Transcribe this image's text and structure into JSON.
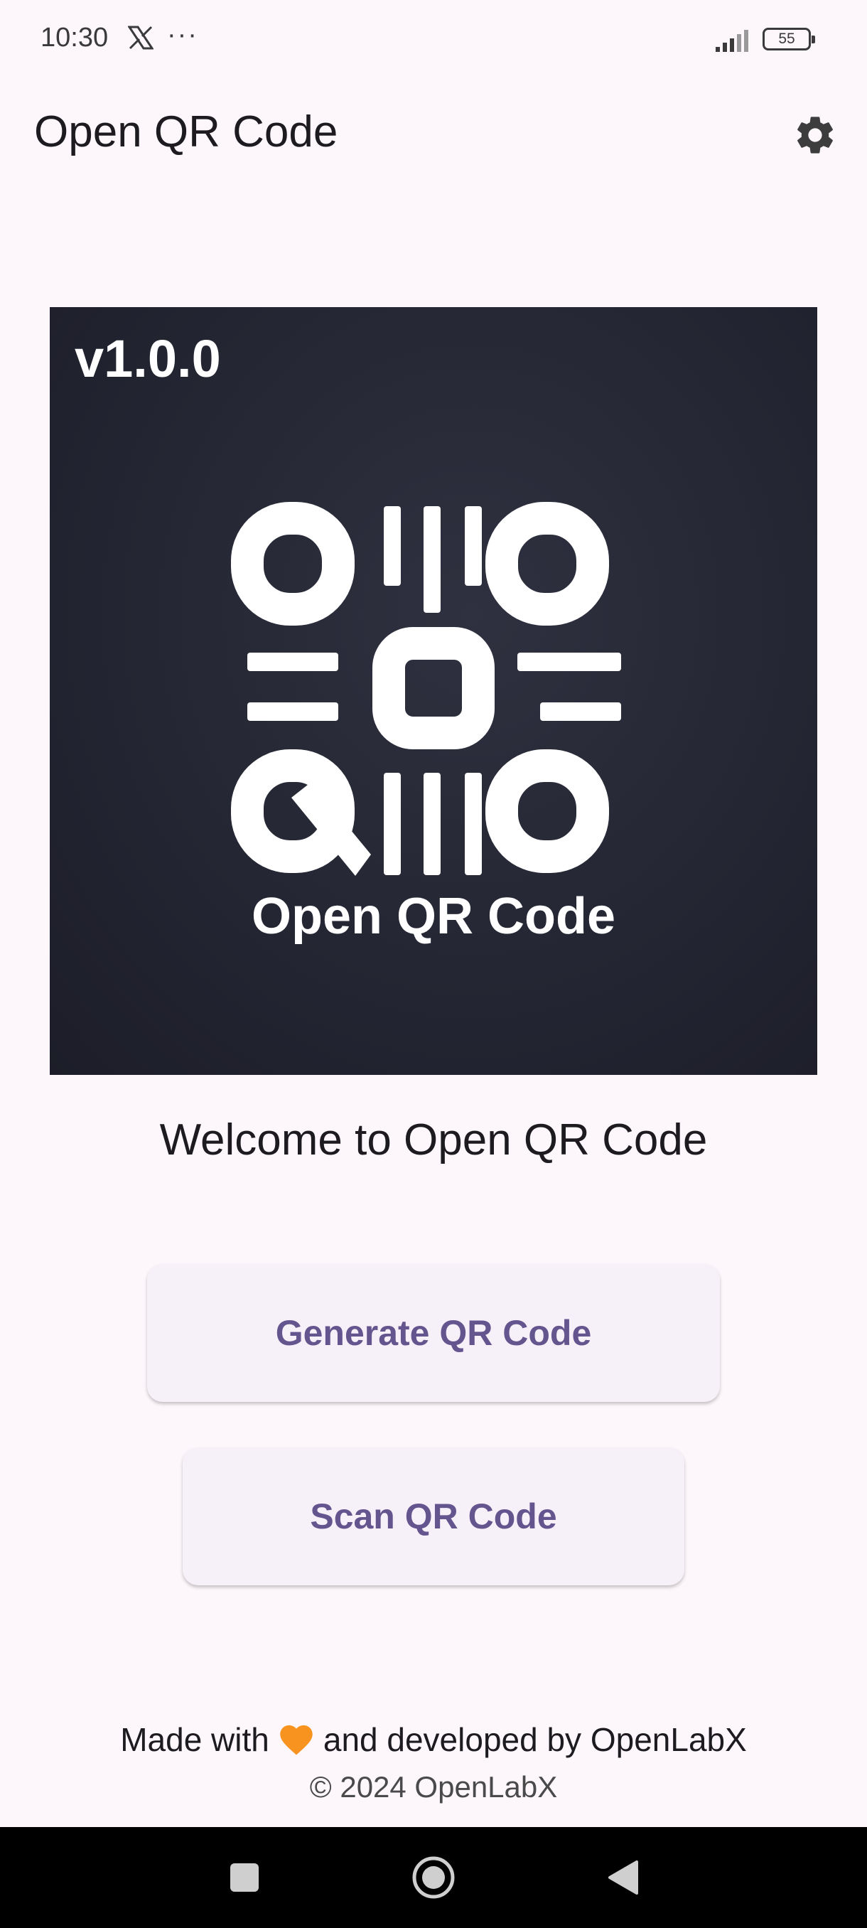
{
  "status_bar": {
    "time": "10:30",
    "x_icon": "x-logo-icon",
    "more": "···",
    "battery": "55"
  },
  "app_bar": {
    "title": "Open QR Code",
    "settings_icon": "gear-icon"
  },
  "banner": {
    "version": "v1.0.0",
    "name": "Open QR Code"
  },
  "welcome": "Welcome to Open QR Code",
  "buttons": {
    "generate": "Generate QR Code",
    "scan": "Scan QR Code"
  },
  "footer": {
    "made_with": "Made with",
    "developed_by": "and developed by OpenLabX",
    "copyright": "© 2024 OpenLabX"
  },
  "colors": {
    "background": "#FDF7FC",
    "accent": "#65558F",
    "button_bg": "#F6F1F8",
    "heart": "#F7931E"
  }
}
